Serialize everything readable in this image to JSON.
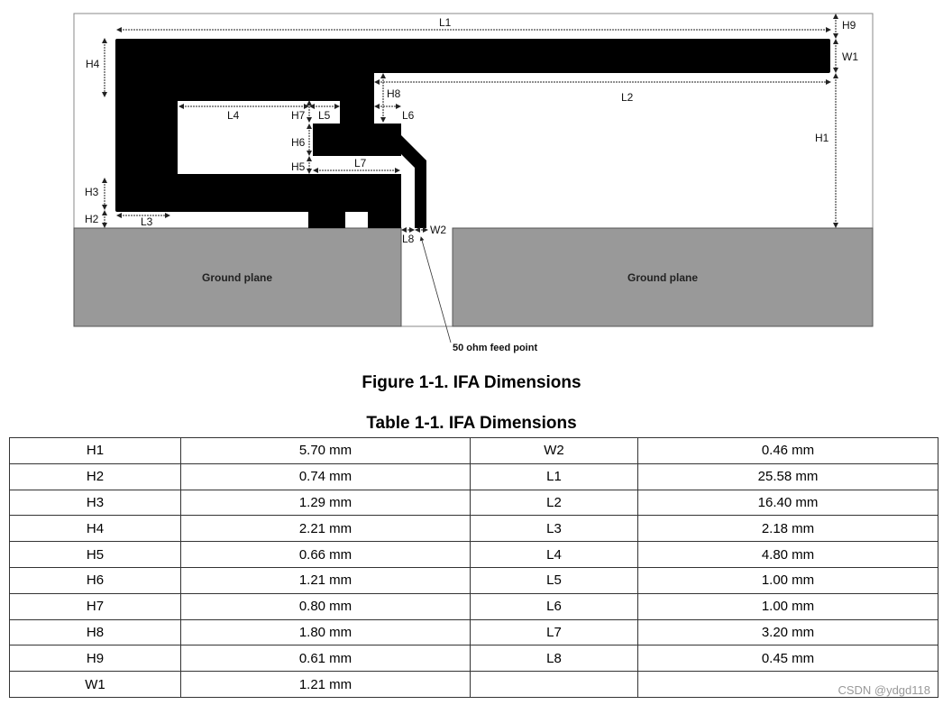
{
  "figure": {
    "labels": {
      "L1": "L1",
      "L2": "L2",
      "L3": "L3",
      "L4": "L4",
      "L5": "L5",
      "L6": "L6",
      "L7": "L7",
      "L8": "L8",
      "H1": "H1",
      "H2": "H2",
      "H3": "H3",
      "H4": "H4",
      "H5": "H5",
      "H6": "H6",
      "H7": "H7",
      "H8": "H8",
      "H9": "H9",
      "W1": "W1",
      "W2": "W2"
    },
    "ground_plane_left": "Ground plane",
    "ground_plane_right": "Ground plane",
    "feed_point": "50 ohm feed point",
    "colors": {
      "trace": "#000000",
      "ground": "#999999"
    }
  },
  "figure_caption": "Figure 1-1. IFA Dimensions",
  "table_caption": "Table 1-1. IFA Dimensions",
  "table": {
    "rows": [
      [
        "H1",
        "5.70 mm",
        "W2",
        "0.46 mm"
      ],
      [
        "H2",
        "0.74 mm",
        "L1",
        "25.58 mm"
      ],
      [
        "H3",
        "1.29 mm",
        "L2",
        "16.40 mm"
      ],
      [
        "H4",
        "2.21 mm",
        "L3",
        "2.18 mm"
      ],
      [
        "H5",
        "0.66 mm",
        "L4",
        "4.80 mm"
      ],
      [
        "H6",
        "1.21 mm",
        "L5",
        "1.00 mm"
      ],
      [
        "H7",
        "0.80 mm",
        "L6",
        "1.00 mm"
      ],
      [
        "H8",
        "1.80 mm",
        "L7",
        "3.20 mm"
      ],
      [
        "H9",
        "0.61 mm",
        "L8",
        "0.45 mm"
      ],
      [
        "W1",
        "1.21 mm",
        "",
        ""
      ]
    ]
  },
  "watermark": "CSDN @ydgd118"
}
